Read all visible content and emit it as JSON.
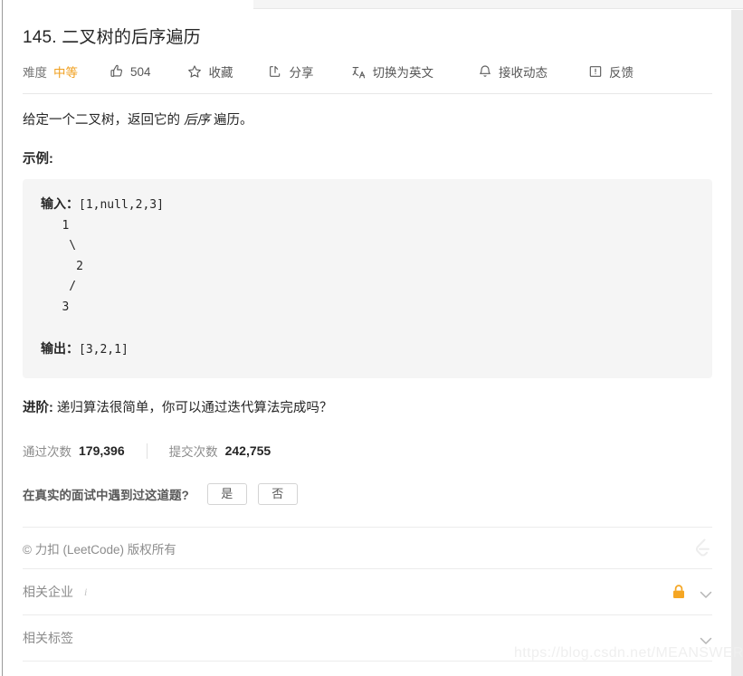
{
  "problem": {
    "title": "145. 二叉树的后序遍历",
    "difficulty_label": "难度",
    "difficulty_value": "中等",
    "difficulty_color": "#f0a020"
  },
  "toolbar": {
    "likes_count": "504",
    "favorite_label": "收藏",
    "share_label": "分享",
    "translate_label": "切换为英文",
    "subscribe_label": "接收动态",
    "feedback_label": "反馈",
    "icons": {
      "like": "thumbs-up-icon",
      "favorite": "star-icon",
      "share": "share-icon",
      "translate": "translate-icon",
      "subscribe": "bell-icon",
      "feedback": "feedback-icon"
    }
  },
  "description": {
    "lead_before": "给定一个二叉树，返回它的 ",
    "lead_emphasis": "后序",
    "lead_after": " 遍历。",
    "example_heading": "示例:"
  },
  "code_example": {
    "input_label": "输入：",
    "input_value": "[1,null,2,3]",
    "tree": "   1\n    \\\n     2\n    /\n   3",
    "output_label": "输出：",
    "output_value": "[3,2,1]"
  },
  "followup": {
    "label": "进阶:",
    "text": " 递归算法很简单，你可以通过迭代算法完成吗？"
  },
  "stats": {
    "accepted_label": "通过次数",
    "accepted_value": "179,396",
    "submissions_label": "提交次数",
    "submissions_value": "242,755"
  },
  "survey": {
    "question": "在真实的面试中遇到过这道题?",
    "yes_label": "是",
    "no_label": "否"
  },
  "footer": {
    "copyright": "© 力扣 (LeetCode) 版权所有",
    "logo": "leetcode-logo-icon"
  },
  "sections": [
    {
      "title": "相关企业",
      "info_mark": "i",
      "has_lock": true,
      "lock_color": "#f5a623"
    },
    {
      "title": "相关标签",
      "info_mark": "",
      "has_lock": false,
      "lock_color": ""
    }
  ],
  "watermark": {
    "text": "https://blog.csdn.net/MEANSWER"
  }
}
